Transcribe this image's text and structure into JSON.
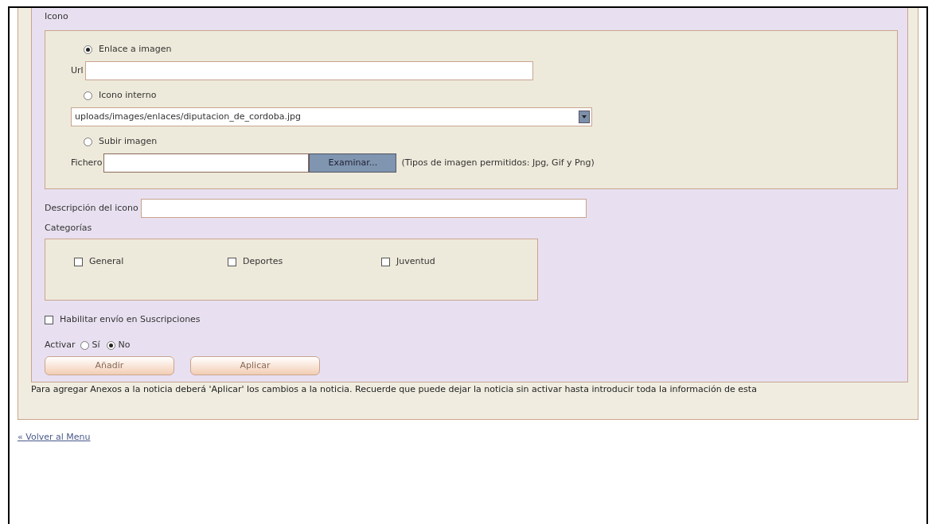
{
  "icon_section": {
    "label": "Icono",
    "options": [
      {
        "kind": "url",
        "label": "Enlace a imagen",
        "selected": true,
        "field_label": "Url"
      },
      {
        "kind": "select",
        "label": "Icono interno",
        "selected": false,
        "value": "uploads/images/enlaces/diputacion_de_cordoba.jpg"
      },
      {
        "kind": "file",
        "label": "Subir imagen",
        "selected": false,
        "field_label": "Fichero",
        "button": "Examinar...",
        "hint": "(Tipos de imagen permitidos: Jpg, Gif y Png)"
      }
    ]
  },
  "description": {
    "label": "Descripción del icono"
  },
  "categories": {
    "label": "Categorías",
    "items": [
      {
        "label": "General",
        "checked": false
      },
      {
        "label": "Deportes",
        "checked": false
      },
      {
        "label": "Juventud",
        "checked": false
      }
    ]
  },
  "subscriptions": {
    "label": "Habilitar envío en Suscripciones",
    "checked": false
  },
  "activate": {
    "label": "Activar",
    "options": [
      {
        "label": "Sí",
        "selected": false
      },
      {
        "label": "No",
        "selected": true
      }
    ]
  },
  "buttons": [
    "Añadir",
    "Aplicar"
  ],
  "note": "Para agregar Anexos a la noticia deberá 'Aplicar' los cambios a la noticia. Recuerde que puede dejar la noticia sin activar hasta introducir toda la información de esta",
  "back_link": "« Volver al Menu"
}
